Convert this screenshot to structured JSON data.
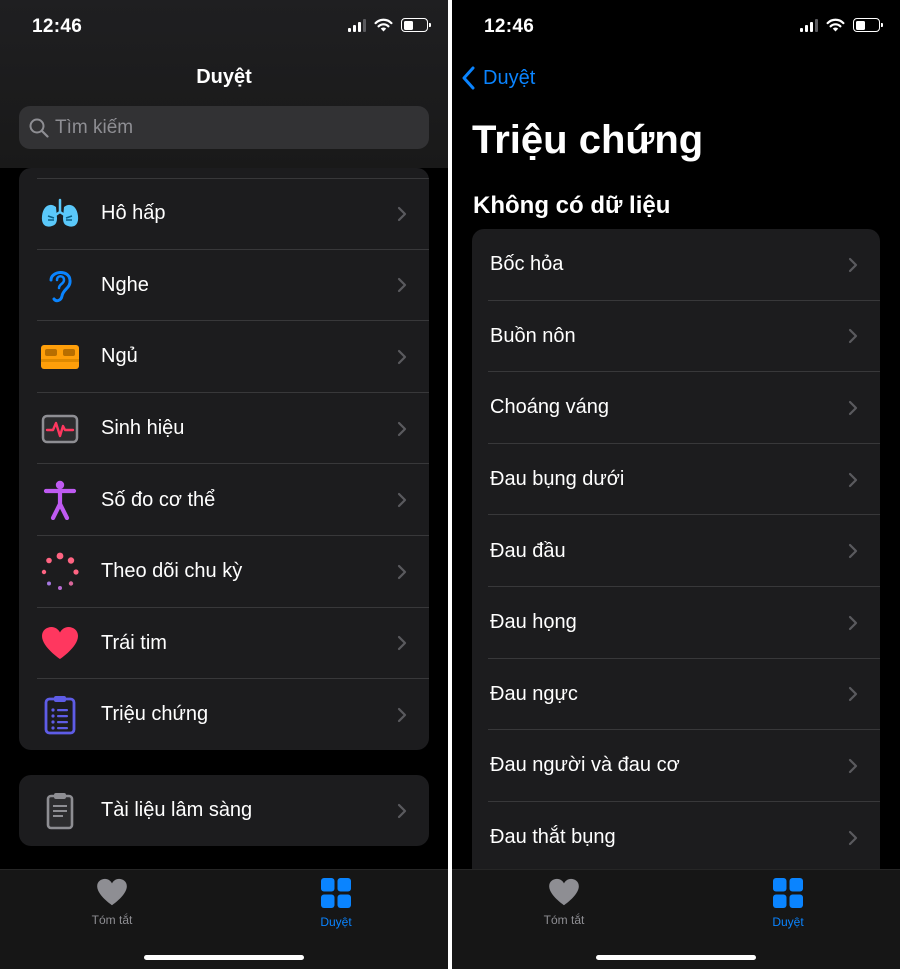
{
  "left": {
    "status_time": "12:46",
    "nav_title": "Duyệt",
    "search_placeholder": "Tìm kiếm",
    "categories": [
      {
        "label": "Hô hấp",
        "icon": "lungs-icon"
      },
      {
        "label": "Nghe",
        "icon": "ear-icon"
      },
      {
        "label": "Ngủ",
        "icon": "bed-icon"
      },
      {
        "label": "Sinh hiệu",
        "icon": "vitals-icon"
      },
      {
        "label": "Số đo cơ thể",
        "icon": "body-figure-icon"
      },
      {
        "label": "Theo dõi chu kỳ",
        "icon": "cycle-tracking-icon"
      },
      {
        "label": "Trái tim",
        "icon": "heart-icon"
      },
      {
        "label": "Triệu chứng",
        "icon": "clipboard-list-icon"
      }
    ],
    "clinical": {
      "label": "Tài liệu lâm sàng",
      "icon": "clinical-document-icon"
    },
    "tabs": [
      {
        "label": "Tóm tắt",
        "icon": "heart-tab-icon"
      },
      {
        "label": "Duyệt",
        "icon": "grid-tab-icon"
      }
    ]
  },
  "right": {
    "status_time": "12:46",
    "back_label": "Duyệt",
    "page_title": "Triệu chứng",
    "section_title": "Không có dữ liệu",
    "symptoms": [
      "Bốc hỏa",
      "Buồn nôn",
      "Choáng váng",
      "Đau bụng dưới",
      "Đau đầu",
      "Đau họng",
      "Đau ngực",
      "Đau người và đau cơ",
      "Đau thắt bụng"
    ],
    "tabs": [
      {
        "label": "Tóm tắt",
        "icon": "heart-tab-icon"
      },
      {
        "label": "Duyệt",
        "icon": "grid-tab-icon"
      }
    ]
  },
  "colors": {
    "accent": "#0a84ff",
    "background": "#000000",
    "card": "#1c1c1e",
    "separator": "#38383a",
    "inactive": "#8e8e93"
  }
}
